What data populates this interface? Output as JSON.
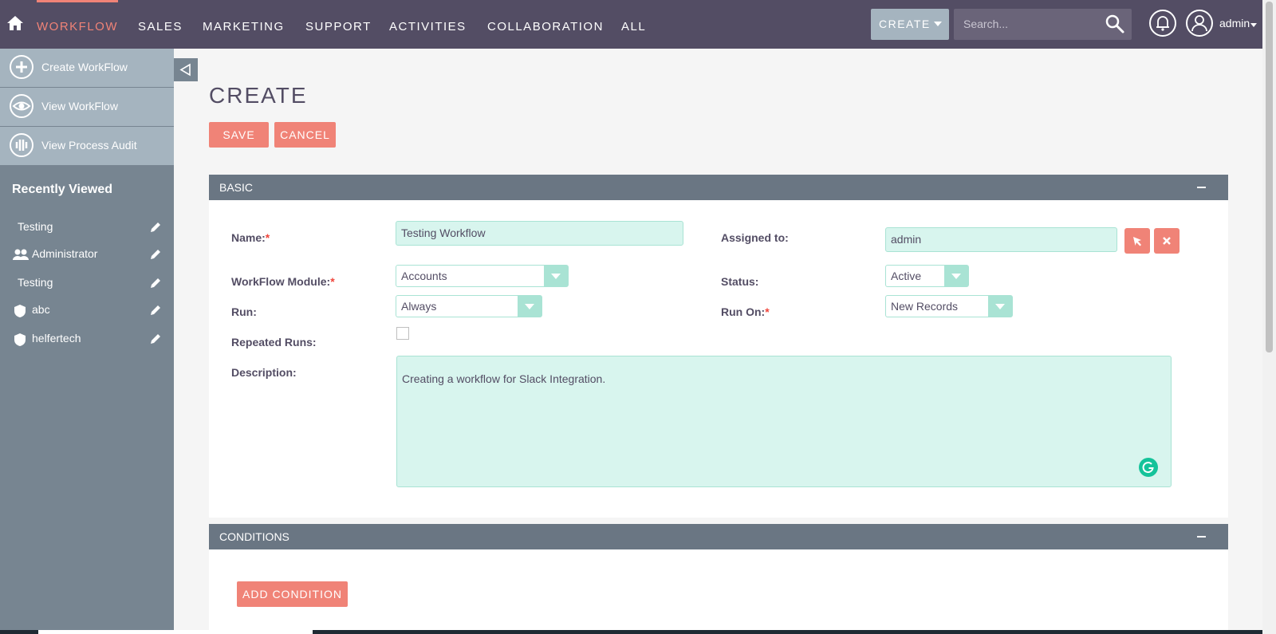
{
  "nav": {
    "items": [
      "WORKFLOW",
      "SALES",
      "MARKETING",
      "SUPPORT",
      "ACTIVITIES",
      "COLLABORATION",
      "ALL"
    ],
    "create_label": "CREATE",
    "search_placeholder": "Search...",
    "user_name": "admin"
  },
  "sidebar": {
    "actions": [
      "Create WorkFlow",
      "View WorkFlow",
      "View Process Audit"
    ],
    "recent_title": "Recently Viewed",
    "recent_items": [
      "Testing",
      "Administrator",
      "Testing",
      "abc",
      "helfertech"
    ]
  },
  "page": {
    "title": "CREATE",
    "save_label": "SAVE",
    "cancel_label": "CANCEL"
  },
  "basic": {
    "header": "BASIC",
    "name_label": "Name:",
    "name_value": "Testing Workflow",
    "assigned_label": "Assigned to:",
    "assigned_value": "admin",
    "module_label": "WorkFlow Module:",
    "module_value": "Accounts",
    "status_label": "Status:",
    "status_value": "Active",
    "run_label": "Run:",
    "run_value": "Always",
    "run_on_label": "Run On:",
    "run_on_value": "New Records",
    "repeated_label": "Repeated Runs:",
    "description_label": "Description:",
    "description_value": "Creating a workflow for Slack Integration.",
    "required_mark": "*"
  },
  "conditions": {
    "header": "CONDITIONS",
    "add_label": "ADD CONDITION"
  },
  "colors": {
    "nav_bg": "#534d64",
    "accent": "#f08377",
    "sidebar_bg": "#778591",
    "panel_header": "#6a7683",
    "field_bg": "#d8f5ee"
  },
  "icons": [
    "home-icon",
    "search-icon",
    "bell-icon",
    "user-icon",
    "plus-icon",
    "eye-icon",
    "audit-icon",
    "pencil-icon",
    "users-icon",
    "shield-icon",
    "collapse-icon",
    "select-arrow-icon",
    "close-icon",
    "grammarly-icon",
    "minus-icon"
  ]
}
